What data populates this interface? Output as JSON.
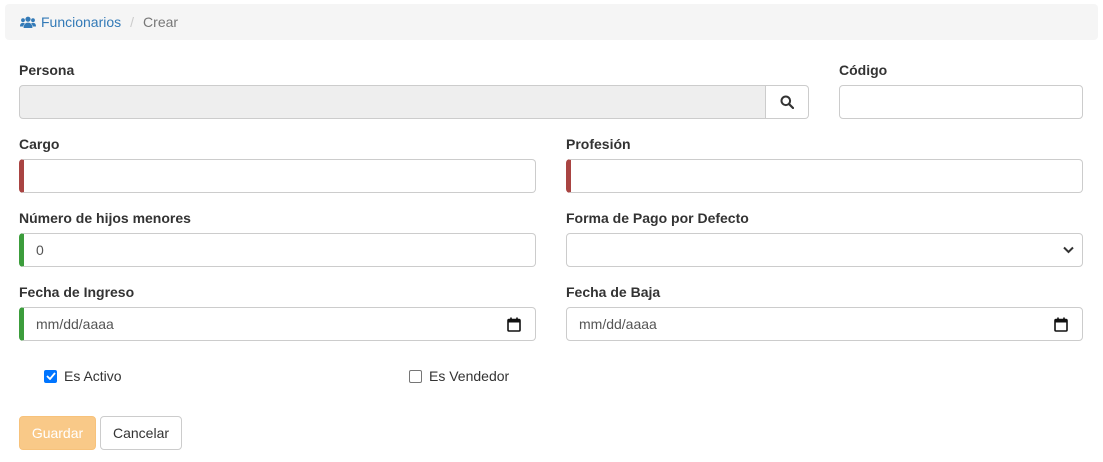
{
  "breadcrumb": {
    "parent": "Funcionarios",
    "separator": "/",
    "current": "Crear"
  },
  "form": {
    "persona": {
      "label": "Persona",
      "value": ""
    },
    "codigo": {
      "label": "Código",
      "value": ""
    },
    "cargo": {
      "label": "Cargo",
      "value": ""
    },
    "profesion": {
      "label": "Profesión",
      "value": ""
    },
    "hijos": {
      "label": "Número de hijos menores",
      "value": "0"
    },
    "forma_pago": {
      "label": "Forma de Pago por Defecto",
      "value": ""
    },
    "fecha_ingreso": {
      "label": "Fecha de Ingreso",
      "placeholder": "mm/dd/aaaa"
    },
    "fecha_baja": {
      "label": "Fecha de Baja",
      "placeholder": "mm/dd/aaaa"
    },
    "es_activo": {
      "label": "Es Activo",
      "checked": true
    },
    "es_vendedor": {
      "label": "Es Vendedor",
      "checked": false
    }
  },
  "buttons": {
    "save": "Guardar",
    "cancel": "Cancelar"
  },
  "icons": {
    "breadcrumb": "users-icon",
    "persona_search": "search-icon",
    "date": "calendar-icon",
    "select": "chevron-down-icon",
    "check": "checkmark-icon"
  },
  "colors": {
    "link": "#337ab7",
    "invalid": "#a94442",
    "valid": "#3c9d3c",
    "primary_disabled": "#f9c988",
    "checkbox": "#0075ff"
  }
}
